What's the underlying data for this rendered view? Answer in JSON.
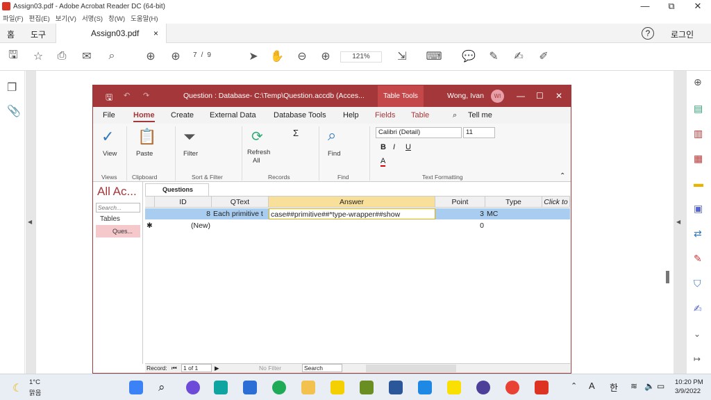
{
  "window": {
    "title": "Assign03.pdf - Adobe Acrobat Reader DC (64-bit)",
    "min": "—",
    "max": "⧉",
    "close": "✕"
  },
  "menu": [
    "파일(F)",
    "편집(E)",
    "보기(V)",
    "서명(S)",
    "창(W)",
    "도움말(H)"
  ],
  "tabs": {
    "home": "홈",
    "tools": "도구",
    "doc": "Assign03.pdf",
    "doc_close": "×",
    "help": "?",
    "login": "로그인"
  },
  "toolbar": {
    "page_current": "7",
    "page_sep": "/",
    "page_total": "9",
    "zoom": "121%"
  },
  "access": {
    "title": "Question : Database- C:\\Temp\\Question.accdb (Acces...",
    "table_tools": "Table Tools",
    "user": "Wong, Ivan",
    "initials": "WI",
    "tabs": [
      "File",
      "Home",
      "Create",
      "External Data",
      "Database Tools",
      "Help",
      "Fields",
      "Table"
    ],
    "tell_me": "Tell me",
    "ribbon": {
      "view": "View",
      "paste": "Paste",
      "filter": "Filter",
      "refresh": "Refresh",
      "refresh2": "All",
      "find": "Find",
      "font": "Calibri (Detail)",
      "size": "11",
      "groups": [
        "Views",
        "Clipboard",
        "Sort & Filter",
        "Records",
        "Find",
        "Text Formatting"
      ]
    },
    "nav": {
      "header": "All Ac...",
      "search": "Search...",
      "tables": "Tables",
      "item": "Ques..."
    },
    "datasheet": {
      "tab": "Questions",
      "columns": [
        "ID",
        "QText",
        "Answer",
        "Point",
        "Type",
        "Click to"
      ],
      "row": {
        "id": "8",
        "qtext": "Each primitive t",
        "answer": "case##primitive##*type-wrapper##show",
        "point": "3",
        "type": "MC"
      },
      "new_row": {
        "label": "(New)",
        "point": "0"
      }
    },
    "recnav": {
      "label": "Record:",
      "pos": "1 of 1",
      "nofilter": "No Filter",
      "search": "Search"
    }
  },
  "taskbar": {
    "temp": "1°C",
    "weather": "맑음",
    "time": "10:20 PM",
    "date": "3/9/2022",
    "lang": "A",
    "ime": "한"
  }
}
